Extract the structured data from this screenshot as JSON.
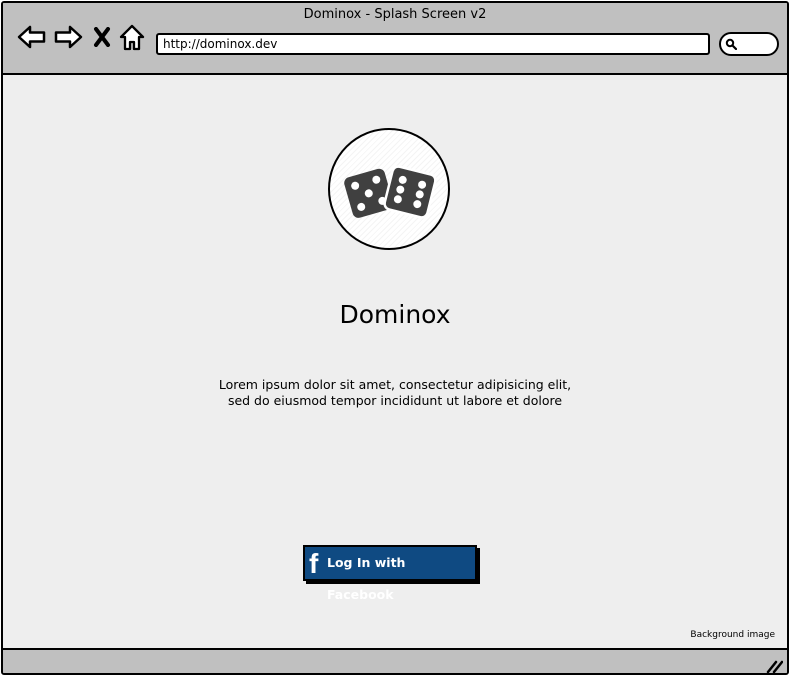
{
  "window": {
    "title": "Dominox - Splash Screen v2"
  },
  "toolbar": {
    "back_icon": "back-arrow-icon",
    "forward_icon": "forward-arrow-icon",
    "stop_icon": "close-icon",
    "home_icon": "home-icon",
    "url": "http://dominox.dev",
    "search_icon": "search-icon"
  },
  "content": {
    "logo_icon": "dice-icon",
    "app_name": "Dominox",
    "tagline_line1": "Lorem ipsum dolor sit amet, consectetur adipisicing elit,",
    "tagline_line2": "sed do eiusmod tempor incididunt ut labore et dolore",
    "login_button": {
      "icon": "facebook-icon",
      "icon_glyph": "f",
      "label": "Log In with Facebook"
    },
    "background_note": "Background image"
  },
  "colors": {
    "chrome": "#c0c0c0",
    "canvas": "#eeeeee",
    "facebook_blue": "#0f4a82",
    "dice": "#404040"
  }
}
